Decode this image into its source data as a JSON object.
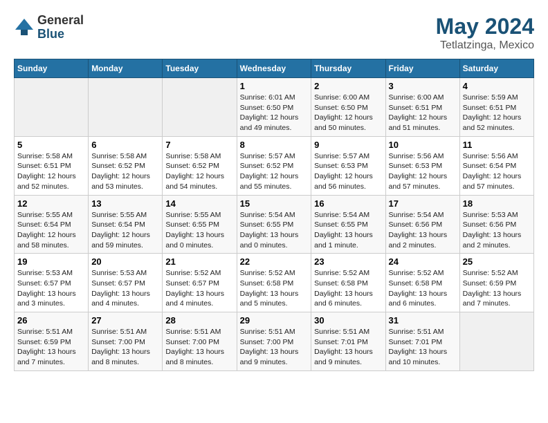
{
  "logo": {
    "general": "General",
    "blue": "Blue"
  },
  "title": "May 2024",
  "subtitle": "Tetlatzinga, Mexico",
  "days_of_week": [
    "Sunday",
    "Monday",
    "Tuesday",
    "Wednesday",
    "Thursday",
    "Friday",
    "Saturday"
  ],
  "weeks": [
    [
      {
        "day": "",
        "info": ""
      },
      {
        "day": "",
        "info": ""
      },
      {
        "day": "",
        "info": ""
      },
      {
        "day": "1",
        "info": "Sunrise: 6:01 AM\nSunset: 6:50 PM\nDaylight: 12 hours\nand 49 minutes."
      },
      {
        "day": "2",
        "info": "Sunrise: 6:00 AM\nSunset: 6:50 PM\nDaylight: 12 hours\nand 50 minutes."
      },
      {
        "day": "3",
        "info": "Sunrise: 6:00 AM\nSunset: 6:51 PM\nDaylight: 12 hours\nand 51 minutes."
      },
      {
        "day": "4",
        "info": "Sunrise: 5:59 AM\nSunset: 6:51 PM\nDaylight: 12 hours\nand 52 minutes."
      }
    ],
    [
      {
        "day": "5",
        "info": "Sunrise: 5:58 AM\nSunset: 6:51 PM\nDaylight: 12 hours\nand 52 minutes."
      },
      {
        "day": "6",
        "info": "Sunrise: 5:58 AM\nSunset: 6:52 PM\nDaylight: 12 hours\nand 53 minutes."
      },
      {
        "day": "7",
        "info": "Sunrise: 5:58 AM\nSunset: 6:52 PM\nDaylight: 12 hours\nand 54 minutes."
      },
      {
        "day": "8",
        "info": "Sunrise: 5:57 AM\nSunset: 6:52 PM\nDaylight: 12 hours\nand 55 minutes."
      },
      {
        "day": "9",
        "info": "Sunrise: 5:57 AM\nSunset: 6:53 PM\nDaylight: 12 hours\nand 56 minutes."
      },
      {
        "day": "10",
        "info": "Sunrise: 5:56 AM\nSunset: 6:53 PM\nDaylight: 12 hours\nand 57 minutes."
      },
      {
        "day": "11",
        "info": "Sunrise: 5:56 AM\nSunset: 6:54 PM\nDaylight: 12 hours\nand 57 minutes."
      }
    ],
    [
      {
        "day": "12",
        "info": "Sunrise: 5:55 AM\nSunset: 6:54 PM\nDaylight: 12 hours\nand 58 minutes."
      },
      {
        "day": "13",
        "info": "Sunrise: 5:55 AM\nSunset: 6:54 PM\nDaylight: 12 hours\nand 59 minutes."
      },
      {
        "day": "14",
        "info": "Sunrise: 5:55 AM\nSunset: 6:55 PM\nDaylight: 13 hours\nand 0 minutes."
      },
      {
        "day": "15",
        "info": "Sunrise: 5:54 AM\nSunset: 6:55 PM\nDaylight: 13 hours\nand 0 minutes."
      },
      {
        "day": "16",
        "info": "Sunrise: 5:54 AM\nSunset: 6:55 PM\nDaylight: 13 hours\nand 1 minute."
      },
      {
        "day": "17",
        "info": "Sunrise: 5:54 AM\nSunset: 6:56 PM\nDaylight: 13 hours\nand 2 minutes."
      },
      {
        "day": "18",
        "info": "Sunrise: 5:53 AM\nSunset: 6:56 PM\nDaylight: 13 hours\nand 2 minutes."
      }
    ],
    [
      {
        "day": "19",
        "info": "Sunrise: 5:53 AM\nSunset: 6:57 PM\nDaylight: 13 hours\nand 3 minutes."
      },
      {
        "day": "20",
        "info": "Sunrise: 5:53 AM\nSunset: 6:57 PM\nDaylight: 13 hours\nand 4 minutes."
      },
      {
        "day": "21",
        "info": "Sunrise: 5:52 AM\nSunset: 6:57 PM\nDaylight: 13 hours\nand 4 minutes."
      },
      {
        "day": "22",
        "info": "Sunrise: 5:52 AM\nSunset: 6:58 PM\nDaylight: 13 hours\nand 5 minutes."
      },
      {
        "day": "23",
        "info": "Sunrise: 5:52 AM\nSunset: 6:58 PM\nDaylight: 13 hours\nand 6 minutes."
      },
      {
        "day": "24",
        "info": "Sunrise: 5:52 AM\nSunset: 6:58 PM\nDaylight: 13 hours\nand 6 minutes."
      },
      {
        "day": "25",
        "info": "Sunrise: 5:52 AM\nSunset: 6:59 PM\nDaylight: 13 hours\nand 7 minutes."
      }
    ],
    [
      {
        "day": "26",
        "info": "Sunrise: 5:51 AM\nSunset: 6:59 PM\nDaylight: 13 hours\nand 7 minutes."
      },
      {
        "day": "27",
        "info": "Sunrise: 5:51 AM\nSunset: 7:00 PM\nDaylight: 13 hours\nand 8 minutes."
      },
      {
        "day": "28",
        "info": "Sunrise: 5:51 AM\nSunset: 7:00 PM\nDaylight: 13 hours\nand 8 minutes."
      },
      {
        "day": "29",
        "info": "Sunrise: 5:51 AM\nSunset: 7:00 PM\nDaylight: 13 hours\nand 9 minutes."
      },
      {
        "day": "30",
        "info": "Sunrise: 5:51 AM\nSunset: 7:01 PM\nDaylight: 13 hours\nand 9 minutes."
      },
      {
        "day": "31",
        "info": "Sunrise: 5:51 AM\nSunset: 7:01 PM\nDaylight: 13 hours\nand 10 minutes."
      },
      {
        "day": "",
        "info": ""
      }
    ]
  ]
}
